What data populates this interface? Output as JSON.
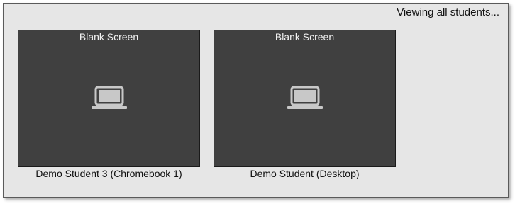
{
  "header": {
    "status_text": "Viewing all students..."
  },
  "students": [
    {
      "name": "Demo Student 3 (Chromebook 1)",
      "screen_label": "Blank Screen",
      "icon": "laptop-icon"
    },
    {
      "name": "Demo Student (Desktop)",
      "screen_label": "Blank Screen",
      "icon": "laptop-icon"
    }
  ],
  "colors": {
    "panel_background": "#e6e6e6",
    "screen_background": "#404040",
    "icon_color": "#c8c8c8"
  }
}
